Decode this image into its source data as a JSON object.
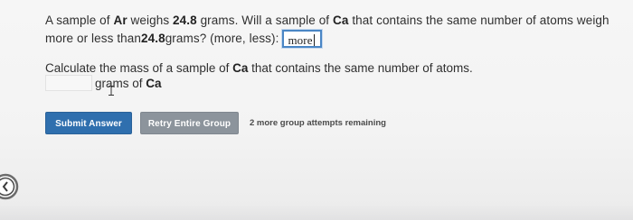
{
  "question": {
    "line1": {
      "t1": "A sample of ",
      "element1": "Ar",
      "t2": " weighs ",
      "mass1": "24.8",
      "t3": " grams. Will a sample of ",
      "element2": "Ca",
      "t4": " that contains the same number of atoms weigh"
    },
    "line2": {
      "t1": "more or less than ",
      "mass2": "24.8",
      "t2": " grams? (more, less):"
    },
    "answer_value": "more"
  },
  "calculation": {
    "prompt_t1": "Calculate the mass of a sample of ",
    "prompt_element": "Ca",
    "prompt_t2": " that contains the same number of atoms.",
    "mass_value": "",
    "unit_t1": "grams of ",
    "unit_element": "Ca"
  },
  "buttons": {
    "submit_label": "Submit Answer",
    "retry_label": "Retry Entire Group"
  },
  "attempts_text": "2 more group attempts remaining",
  "icons": {
    "left_edge": "chevron-circle-icon",
    "cursor": "text-cursor-icon"
  },
  "colors": {
    "submit_button": "#2f6fae",
    "retry_button": "#8c949c",
    "input_focus_border": "#4a86c5"
  }
}
